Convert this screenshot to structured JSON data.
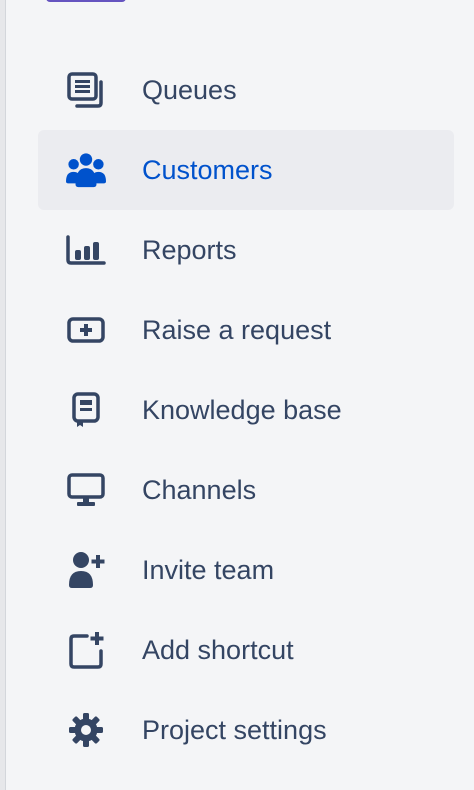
{
  "colors": {
    "text": "#344563",
    "selected_text": "#0052cc",
    "selected_bg": "#ebecf0",
    "icon": "#344563",
    "selected_icon": "#0052cc",
    "accent": "#6554c0"
  },
  "sidebar": {
    "items": [
      {
        "label": "Queues",
        "icon": "queues-icon"
      },
      {
        "label": "Customers",
        "icon": "customers-icon",
        "selected": true
      },
      {
        "label": "Reports",
        "icon": "reports-icon"
      },
      {
        "label": "Raise a request",
        "icon": "raise-request-icon"
      },
      {
        "label": "Knowledge base",
        "icon": "knowledge-base-icon"
      },
      {
        "label": "Channels",
        "icon": "channels-icon"
      },
      {
        "label": "Invite team",
        "icon": "invite-team-icon"
      },
      {
        "label": "Add shortcut",
        "icon": "add-shortcut-icon"
      },
      {
        "label": "Project settings",
        "icon": "gear-icon"
      }
    ]
  }
}
